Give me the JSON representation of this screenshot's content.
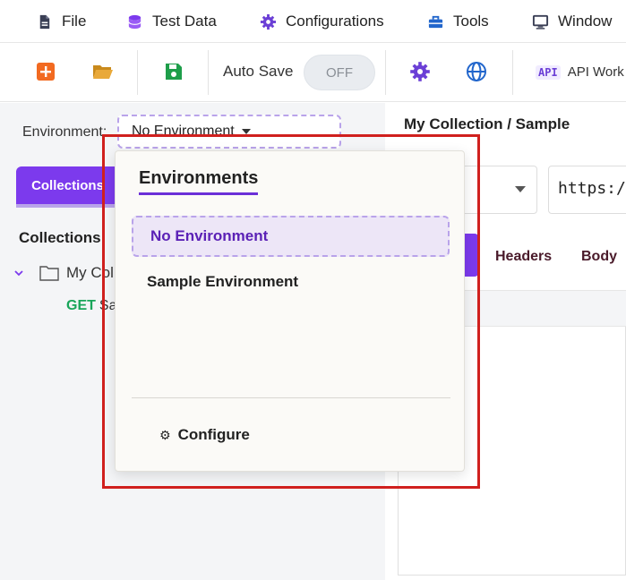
{
  "menubar": {
    "items": [
      {
        "label": "File",
        "icon": "file-icon"
      },
      {
        "label": "Test Data",
        "icon": "database-icon"
      },
      {
        "label": "Configurations",
        "icon": "gear-icon"
      },
      {
        "label": "Tools",
        "icon": "toolbox-icon"
      },
      {
        "label": "Window",
        "icon": "monitor-icon"
      }
    ]
  },
  "toolbar": {
    "autosave_label": "Auto Save",
    "autosave_state": "OFF",
    "api_badge": "API",
    "api_label": "API Work"
  },
  "sidebar": {
    "environment_label": "Environment:",
    "environment_value": "No Environment",
    "tab_label": "Collections",
    "collections_title": "Collections",
    "tree": {
      "collection_name": "My Coll",
      "request_method": "GET",
      "request_name": "Sa"
    }
  },
  "main": {
    "breadcrumb": "My Collection / Sample",
    "url": "https:/",
    "tabs": [
      "Headers",
      "Body"
    ]
  },
  "popup": {
    "title": "Environments",
    "options": [
      "No Environment",
      "Sample Environment"
    ],
    "selected": "No Environment",
    "configure_icon": "⚙",
    "configure_label": "Configure"
  },
  "colors": {
    "accent": "#7c3aed",
    "highlight": "#d0201e",
    "get_method": "#19a55a",
    "add_button": "#f26a21",
    "folder": "#e0a030",
    "save": "#1e9e4a",
    "globe": "#2266cc"
  }
}
